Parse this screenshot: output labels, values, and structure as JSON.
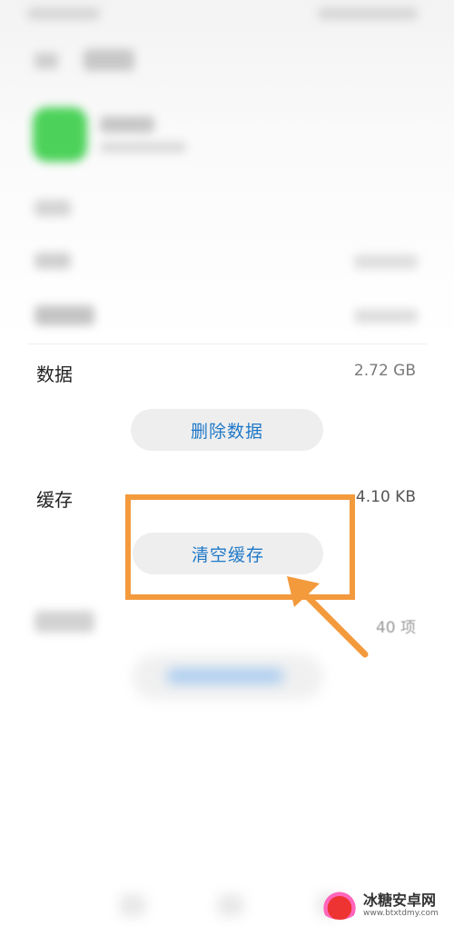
{
  "status_bar": {
    "time": "",
    "right": ""
  },
  "header": {
    "title": ""
  },
  "app": {
    "name": "",
    "subtitle": "",
    "icon_color": "#4cd25a"
  },
  "blurred_rows": [
    {
      "label": "",
      "value": ""
    },
    {
      "label": "",
      "value": ""
    },
    {
      "label": "",
      "value": ""
    }
  ],
  "data_row": {
    "label": "数据",
    "value": "2.72 GB"
  },
  "delete_data_button": {
    "label": "删除数据"
  },
  "cache_row": {
    "label": "缓存",
    "value": "4.10 KB"
  },
  "clear_cache_button": {
    "label": "清空缓存"
  },
  "items_row": {
    "label": "",
    "value": "40 项"
  },
  "watermark": {
    "title": "冰糖安卓网",
    "url": "www.btxtdmy.com"
  },
  "colors": {
    "accent": "#1f78c8",
    "highlight": "#f39a3d",
    "pill_bg": "#eeeeee"
  }
}
